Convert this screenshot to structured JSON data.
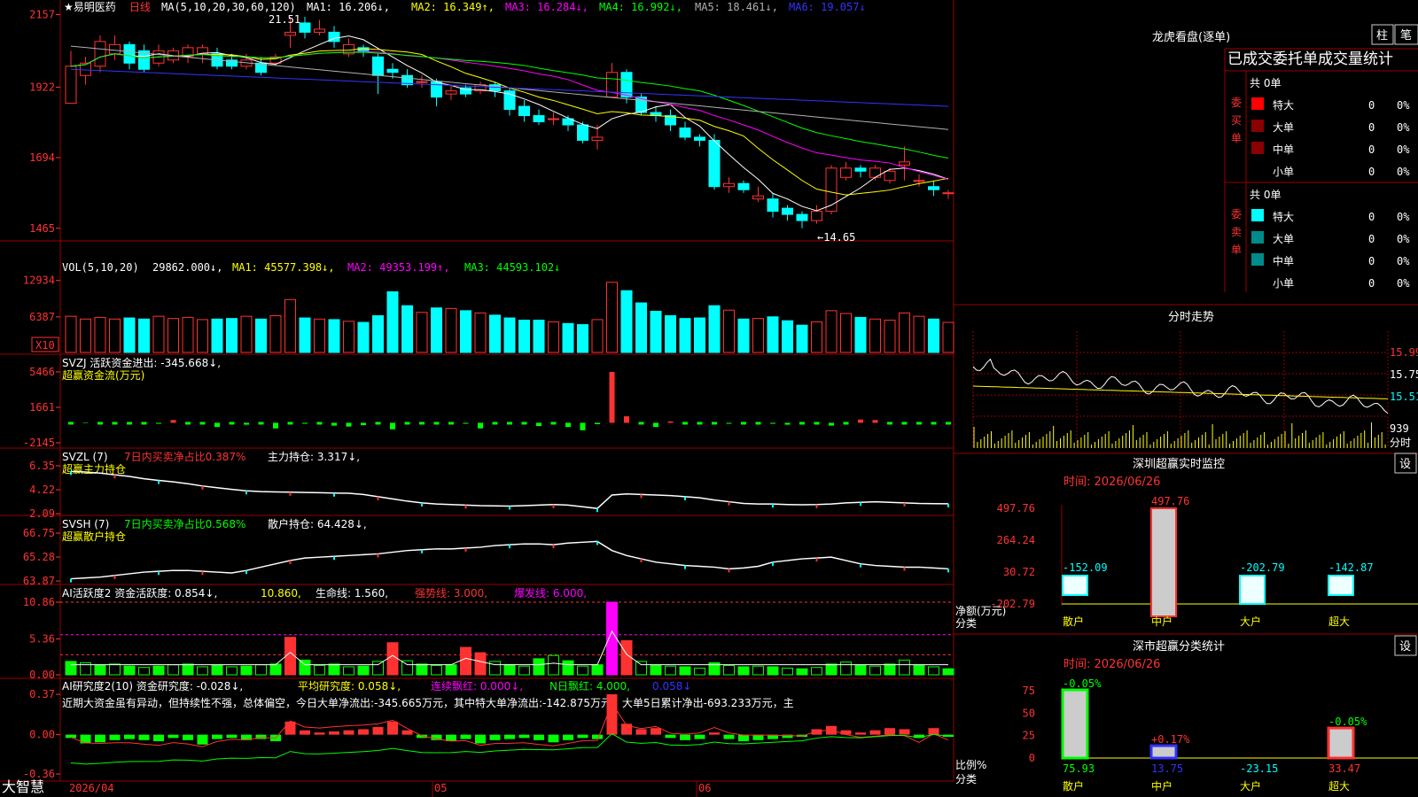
{
  "app": {
    "logo": "大智慧"
  },
  "colors": {
    "up": "#ff3232",
    "down": "#00ffff",
    "green": "#00ff00",
    "yellow": "#ffff00",
    "magenta": "#ff00ff",
    "white": "#ffffff",
    "blue": "#3333ff",
    "gray": "#b0b0b0",
    "grid": "#990000",
    "axis": "#ff3232"
  },
  "price_panel": {
    "stock": "★易明医药",
    "period": "日线",
    "ma_params": "MA(5,10,20,30,60,120)",
    "ma_values": [
      "MA1: 16.206↓,",
      "MA2: 16.349↑,",
      "MA3: 16.284↓,",
      "MA4: 16.992↓,",
      "MA5: 18.461↓,",
      "MA6: 19.057↓"
    ],
    "ticks": [
      "2157",
      "1922",
      "1694",
      "1465"
    ],
    "high_label": "21.51",
    "low_label": "←14.65"
  },
  "vol_panel": {
    "title": "VOL(5,10,20)",
    "value": "29862.000↓,",
    "ma": [
      "MA1: 45577.398↓,",
      "MA2: 49353.199↑,",
      "MA3: 44593.102↓"
    ],
    "ticks": [
      "12934",
      "6387"
    ],
    "unit": "X10"
  },
  "svzj_panel": {
    "title": "SVZJ  活跃资金进出: -345.668↓,",
    "sub": "超赢资金流(万元)",
    "ticks": [
      "5466",
      "1661",
      "-2145"
    ]
  },
  "svzl_panel": {
    "t1": "SVZL (7)",
    "t2": "7日内买卖净占比0.387%",
    "t3": "主力持仓: 3.317↓,",
    "sub": "超赢主力持仓",
    "ticks": [
      "6.35",
      "4.22",
      "2.09"
    ]
  },
  "svsh_panel": {
    "t1": "SVSH (7)",
    "t2": "7日内买卖净占比0.568%",
    "t3": "散户持仓: 64.428↓,",
    "sub": "超赢散户持仓",
    "ticks": [
      "66.75",
      "65.28",
      "63.87"
    ]
  },
  "ai_act_panel": {
    "t1": "AI活跃度2 资金活跃度: 0.854↓,",
    "t2": "10.860,",
    "t3": "生命线: 1.560,",
    "t4": "强势线: 3.000,",
    "t5": "爆发线: 6.000,",
    "ticks": [
      "10.86",
      "5.36",
      "0.00"
    ]
  },
  "ai_res_panel": {
    "t1": "AI研究度2(10) 资金研究度: -0.028↓,",
    "t2": "平均研究度: 0.058↓,",
    "t3": "连续飘红: 0.000↓,",
    "t4": "N日飘红: 4.000,",
    "t5": "0.058↓",
    "commentary": "近期大资金虽有异动，但持续性不强，总体偏空，今日大单净流出:-345.665万元，其中特大单净流出:-142.875万元，大单5日累计净出-693.233万元，主",
    "ticks": [
      "0.37",
      "0.00",
      "-0.36"
    ]
  },
  "date_axis": {
    "labels": [
      "2026/04",
      "05",
      "06"
    ]
  },
  "right": {
    "dragon_title": "龙虎看盘(逐单)",
    "btn_zhu": "柱",
    "btn_bi": "笔",
    "stats_header": "已成交委托单成交量统计",
    "buy": {
      "side_label": "委买单",
      "total": "共 0单",
      "rows": [
        {
          "label": "特大",
          "qty": "0",
          "pct": "0%"
        },
        {
          "label": "大单",
          "qty": "0",
          "pct": "0%"
        },
        {
          "label": "中单",
          "qty": "0",
          "pct": "0%"
        },
        {
          "label": "小单",
          "qty": "0",
          "pct": "0%"
        }
      ]
    },
    "sell": {
      "side_label": "委卖单",
      "total": "共 0单",
      "rows": [
        {
          "label": "特大",
          "qty": "0",
          "pct": "0%"
        },
        {
          "label": "大单",
          "qty": "0",
          "pct": "0%"
        },
        {
          "label": "中单",
          "qty": "0",
          "pct": "0%"
        },
        {
          "label": "小单",
          "qty": "0",
          "pct": "0%"
        }
      ]
    },
    "intraday_title": "分时走势",
    "intraday_ticks": [
      "15.99",
      "15.75",
      "15.51",
      "939"
    ],
    "intraday_xlabel": "分时",
    "sz_title": "深圳超赢实时监控",
    "set_btn": "设",
    "sz_time": "时间: 2026/06/26",
    "sz_ticks": [
      "497.76",
      "264.24",
      "30.72",
      "-202.79"
    ],
    "sz_ylabel": [
      "净额(万元)",
      "分类"
    ],
    "sz_categories": [
      "散户",
      "中户",
      "大户",
      "超大"
    ],
    "sz_values": [
      -152.09,
      497.76,
      -202.79,
      -142.87
    ],
    "sz_value_labels": [
      "-152.09",
      "497.76",
      "-202.79",
      "-142.87"
    ],
    "sc_title": "深市超赢分类统计",
    "sc_time": "时间: 2026/06/26",
    "sc_ticks": [
      "75",
      "50",
      "25",
      "0"
    ],
    "sc_ylabel": [
      "比例%",
      "分类"
    ],
    "sc_categories": [
      "散户",
      "中户",
      "大户",
      "超大"
    ],
    "sc_values": [
      75.93,
      13.75,
      -23.15,
      33.47
    ],
    "sc_bottom_labels": [
      "75.93",
      "13.75",
      "-23.15",
      "33.47"
    ],
    "sc_change_labels": [
      "-0.05%",
      "+0.17%",
      "",
      "-0.05%"
    ]
  },
  "chart_data": [
    {
      "type": "candlestick",
      "title": "易明医药 日线",
      "ylim": [
        14.3,
        21.7
      ],
      "candles": [
        [
          18.7,
          19.9,
          18.9,
          20.4
        ],
        [
          19.6,
          20.0,
          19.3,
          20.2
        ],
        [
          19.9,
          20.7,
          19.7,
          20.9
        ],
        [
          20.3,
          20.6,
          20.1,
          20.9
        ],
        [
          20.6,
          20.0,
          19.8,
          20.7
        ],
        [
          20.4,
          19.8,
          19.7,
          20.6
        ],
        [
          20.0,
          20.4,
          19.9,
          20.6
        ],
        [
          20.1,
          20.4,
          20.0,
          20.5
        ],
        [
          20.2,
          20.5,
          20.0,
          20.6
        ],
        [
          20.3,
          20.5,
          20.0,
          20.6
        ],
        [
          20.3,
          19.9,
          19.8,
          20.5
        ],
        [
          20.1,
          19.9,
          19.8,
          20.3
        ],
        [
          19.9,
          20.1,
          19.8,
          20.3
        ],
        [
          20.0,
          19.7,
          19.6,
          20.2
        ],
        [
          20.0,
          20.2,
          19.9,
          20.3
        ],
        [
          20.9,
          21.0,
          20.5,
          21.5
        ],
        [
          21.3,
          21.0,
          20.8,
          21.5
        ],
        [
          21.0,
          21.1,
          20.9,
          21.4
        ],
        [
          21.0,
          20.7,
          20.5,
          21.2
        ],
        [
          20.3,
          20.6,
          20.2,
          20.8
        ],
        [
          20.5,
          20.4,
          20.2,
          20.6
        ],
        [
          20.2,
          19.6,
          19.0,
          20.3
        ],
        [
          19.8,
          19.7,
          19.5,
          20.0
        ],
        [
          19.6,
          19.3,
          19.2,
          19.8
        ],
        [
          19.4,
          19.4,
          19.2,
          19.6
        ],
        [
          19.4,
          18.9,
          18.6,
          19.5
        ],
        [
          19.0,
          19.1,
          18.8,
          19.3
        ],
        [
          19.2,
          19.0,
          18.9,
          19.3
        ],
        [
          19.1,
          19.3,
          19.0,
          19.4
        ],
        [
          19.3,
          19.1,
          18.9,
          19.4
        ],
        [
          19.1,
          18.5,
          18.3,
          19.2
        ],
        [
          18.6,
          18.3,
          18.1,
          18.8
        ],
        [
          18.3,
          18.1,
          18.0,
          18.5
        ],
        [
          18.2,
          18.2,
          18.0,
          18.4
        ],
        [
          18.2,
          18.0,
          17.8,
          18.3
        ],
        [
          18.0,
          17.5,
          17.4,
          18.1
        ],
        [
          17.5,
          17.6,
          17.2,
          18.0
        ],
        [
          18.9,
          19.7,
          18.9,
          20.0
        ],
        [
          19.7,
          18.9,
          18.7,
          19.8
        ],
        [
          18.9,
          18.4,
          18.3,
          19.0
        ],
        [
          18.4,
          18.3,
          18.1,
          18.6
        ],
        [
          18.3,
          18.0,
          17.8,
          18.5
        ],
        [
          17.9,
          17.6,
          17.5,
          18.1
        ],
        [
          17.6,
          17.5,
          17.3,
          17.7
        ],
        [
          17.5,
          16.0,
          15.9,
          17.7
        ],
        [
          16.0,
          16.1,
          15.8,
          16.3
        ],
        [
          16.1,
          15.9,
          15.8,
          16.2
        ],
        [
          15.6,
          15.7,
          15.5,
          16.0
        ],
        [
          15.6,
          15.2,
          15.0,
          15.8
        ],
        [
          15.3,
          15.1,
          14.9,
          15.4
        ],
        [
          15.1,
          14.9,
          14.65,
          15.2
        ],
        [
          14.9,
          15.2,
          14.8,
          15.4
        ],
        [
          15.2,
          16.6,
          15.1,
          16.7
        ],
        [
          16.3,
          16.6,
          16.2,
          16.8
        ],
        [
          16.6,
          16.5,
          16.3,
          16.7
        ],
        [
          16.3,
          16.6,
          16.2,
          16.7
        ],
        [
          16.2,
          16.5,
          16.1,
          16.6
        ],
        [
          16.7,
          16.8,
          16.2,
          17.3
        ],
        [
          16.2,
          16.2,
          16.0,
          16.4
        ],
        [
          16.0,
          15.9,
          15.7,
          16.2
        ],
        [
          15.8,
          15.8,
          15.6,
          15.9
        ]
      ],
      "ma_series": [
        "MA1",
        "MA2",
        "MA3",
        "MA4",
        "MA5",
        "MA6"
      ]
    },
    {
      "type": "bar",
      "title": "VOL(5,10,20)",
      "ylim": [
        0,
        14000
      ],
      "values": [
        6500,
        6000,
        6300,
        6000,
        6200,
        6000,
        6500,
        6100,
        6300,
        5900,
        6000,
        6100,
        6500,
        6000,
        6600,
        9500,
        6200,
        6000,
        5900,
        5600,
        5400,
        6600,
        10900,
        8400,
        7200,
        8000,
        7900,
        7500,
        7100,
        6700,
        6200,
        5800,
        5800,
        5500,
        5200,
        5000,
        5900,
        12600,
        11100,
        8900,
        7400,
        6600,
        6100,
        6200,
        8400,
        7600,
        6000,
        6100,
        6400,
        5700,
        4900,
        5500,
        7500,
        7000,
        6300,
        6000,
        5800,
        7100,
        6500,
        6000,
        5400
      ]
    },
    {
      "type": "bar",
      "title": "SVZJ 超赢资金流(万元)",
      "ylim": [
        -2145,
        5466
      ],
      "values": [
        0,
        -50,
        0,
        0,
        0,
        0,
        -100,
        300,
        0,
        0,
        -450,
        0,
        -200,
        0,
        -600,
        0,
        -100,
        0,
        -300,
        -400,
        -250,
        0,
        -700,
        0,
        0,
        0,
        0,
        -100,
        -600,
        0,
        0,
        0,
        -350,
        0,
        -450,
        -800,
        -150,
        5466,
        700,
        0,
        -450,
        150,
        0,
        0,
        0,
        -100,
        0,
        0,
        -100,
        -200,
        0,
        0,
        -300,
        0,
        350,
        300,
        0,
        0,
        0,
        0,
        0
      ]
    },
    {
      "type": "line",
      "title": "SVZL 超赢主力持仓",
      "ylim": [
        2.09,
        6.35
      ],
      "values": [
        5.85,
        5.8,
        5.7,
        5.55,
        5.4,
        5.2,
        5.05,
        4.92,
        4.75,
        4.55,
        4.4,
        4.25,
        4.12,
        4.05,
        4.02,
        4.0,
        3.97,
        3.95,
        3.92,
        3.9,
        3.8,
        3.6,
        3.4,
        3.2,
        3.05,
        2.95,
        2.9,
        2.85,
        2.8,
        2.78,
        2.76,
        2.8,
        2.85,
        2.9,
        2.85,
        2.7,
        2.55,
        3.75,
        3.85,
        3.8,
        3.75,
        3.7,
        3.6,
        3.5,
        3.3,
        3.15,
        3.0,
        2.95,
        2.95,
        2.9,
        2.88,
        2.9,
        2.95,
        3.05,
        3.1,
        3.15,
        3.1,
        3.05,
        3.0,
        2.98,
        2.97
      ]
    },
    {
      "type": "line",
      "title": "SVSH 超赢散户持仓",
      "ylim": [
        63.87,
        66.75
      ],
      "values": [
        64.0,
        64.05,
        64.1,
        64.2,
        64.3,
        64.4,
        64.45,
        64.5,
        64.5,
        64.45,
        64.4,
        64.35,
        64.5,
        64.7,
        64.9,
        65.1,
        65.25,
        65.3,
        65.35,
        65.4,
        65.45,
        65.5,
        65.6,
        65.7,
        65.75,
        65.8,
        65.8,
        65.85,
        65.9,
        66.0,
        66.05,
        66.1,
        66.1,
        66.05,
        66.15,
        66.2,
        66.25,
        65.7,
        65.4,
        65.2,
        65.0,
        64.9,
        64.8,
        64.75,
        64.7,
        64.6,
        64.65,
        64.75,
        65.0,
        65.1,
        65.2,
        65.25,
        65.3,
        65.1,
        64.9,
        64.8,
        64.75,
        64.7,
        64.7,
        64.65,
        64.6
      ]
    },
    {
      "type": "bar",
      "title": "AI活跃度2",
      "ylim": [
        0,
        10.86
      ],
      "values": [
        2,
        1.8,
        1.4,
        1.6,
        1.3,
        1.1,
        1.3,
        1.5,
        1.6,
        1.2,
        1.4,
        1.2,
        1.3,
        1.5,
        1.6,
        5.6,
        2.2,
        1.4,
        1.6,
        1.2,
        1.3,
        2.0,
        4.8,
        2.1,
        1.6,
        1.4,
        1.5,
        4.1,
        3.3,
        2.0,
        1.5,
        1.3,
        2.4,
        2.9,
        2.1,
        1.3,
        1.5,
        10.86,
        5.1,
        2.0,
        1.4,
        1.3,
        1.2,
        1.0,
        1.8,
        1.4,
        1.2,
        1.3,
        1.2,
        1.0,
        0.9,
        1.1,
        1.6,
        1.9,
        1.4,
        1.3,
        1.6,
        2.2,
        1.4,
        1.2,
        0.9
      ]
    },
    {
      "type": "bar",
      "title": "AI研究度2(10)",
      "ylim": [
        -0.36,
        0.37
      ],
      "values": [
        -0.03,
        -0.08,
        -0.07,
        -0.05,
        -0.04,
        -0.05,
        -0.06,
        -0.03,
        -0.05,
        -0.09,
        -0.04,
        -0.03,
        -0.05,
        -0.04,
        -0.06,
        0.12,
        0.04,
        0.02,
        0.03,
        0.04,
        0.05,
        0.07,
        0.12,
        0.04,
        -0.03,
        -0.05,
        -0.06,
        -0.04,
        -0.08,
        -0.05,
        -0.04,
        -0.03,
        -0.05,
        -0.07,
        -0.05,
        -0.03,
        -0.04,
        0.37,
        0.1,
        0.05,
        0.06,
        -0.03,
        -0.05,
        -0.04,
        0.02,
        -0.04,
        -0.06,
        -0.05,
        -0.04,
        -0.03,
        -0.02,
        0.05,
        0.08,
        0.04,
        0.02,
        0.04,
        0.06,
        0.05,
        -0.03,
        0.06,
        -0.02
      ]
    },
    {
      "type": "bar",
      "title": "深圳超赢实时监控",
      "categories": [
        "散户",
        "中户",
        "大户",
        "超大"
      ],
      "values": [
        -152.09,
        497.76,
        -202.79,
        -142.87
      ],
      "ylim": [
        -202.79,
        497.76
      ],
      "ylabel": "净额(万元)",
      "xlabel": "分类"
    },
    {
      "type": "bar",
      "title": "深市超赢分类统计",
      "categories": [
        "散户",
        "中户",
        "大户",
        "超大"
      ],
      "values": [
        75.93,
        13.75,
        -23.15,
        33.47
      ],
      "ylim": [
        0,
        75
      ],
      "ylabel": "比例%",
      "xlabel": "分类"
    }
  ]
}
